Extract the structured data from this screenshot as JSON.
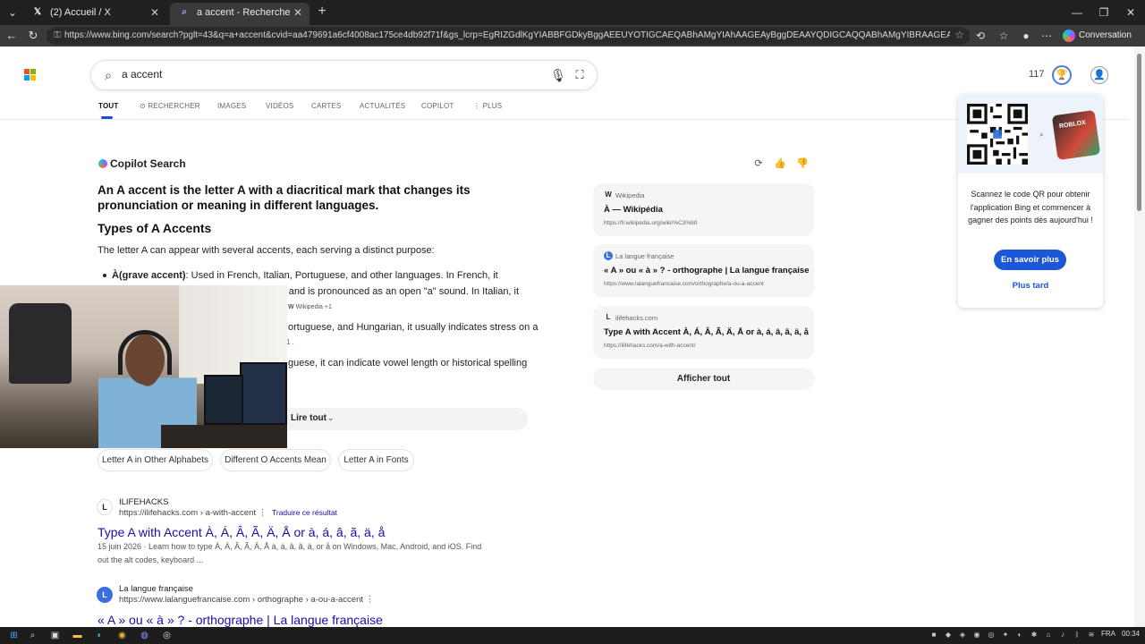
{
  "browser": {
    "tabs": [
      {
        "label": "(2) Accueil / X",
        "icon": "x-logo-icon"
      },
      {
        "label": "a accent - Recherche",
        "icon": "bing-search-icon"
      }
    ],
    "url": "https://www.bing.com/search?pglt=43&q=a+accent&cvid=aa479691a6cf4008ac175ce4db92f71f&gs_lcrp=EgRIZGdlKgYIABBFGDkyBggAEEUYOTIGCAEQABhAMgYIAhAAGEAyBggDEAAYQDIGCAQQABhAMgYIBRAAGEAyBggGEAAYQDIGCA...",
    "conversation_label": "Conversation"
  },
  "bing": {
    "query": "a accent",
    "points": "117",
    "scopes": [
      "TOUT",
      "RECHERCHER",
      "IMAGES",
      "VIDÉOS",
      "CARTES",
      "ACTUALITÉS",
      "COPILOT",
      "PLUS"
    ]
  },
  "copilot": {
    "label": "Copilot Search",
    "headline": "An A accent is the letter A with a diacritical mark that changes its pronunciation or meaning in different languages.",
    "section_title": "Types of A Accents",
    "intro": "The letter A can appear with several accents, each serving a distinct purpose:",
    "bullet_letter": "À",
    "bullet_term": "(grave accent)",
    "bullet_line1": ": Used in French, Italian, Portuguese, and other languages. In French, it",
    "bullet_line2": ") and is pronounced as an open \"a\" sound. In Italian, it",
    "citation": "Wikipedia +1",
    "line3": "ortuguese, and Hungarian, it usually indicates stress on a",
    "line4": "1 .",
    "line5": "guese, it can indicate vowel length or historical spelling",
    "read_all": "Lire tout",
    "chips": [
      "Letter A in Other Alphabets",
      "Different O Accents Mean",
      "Letter A in Fonts"
    ]
  },
  "sources": [
    {
      "site": "Wikipedia",
      "icon": "W",
      "title": "À — Wikipédia",
      "url": "https://fr.wikipedia.org/wiki/%C3%80"
    },
    {
      "site": "La langue française",
      "icon": "L",
      "title": "« A » ou « à » ? - orthographe | La langue française",
      "url": "https://www.lalanguefrancaise.com/orthographe/a-ou-a-accent"
    },
    {
      "site": "ilifehacks.com",
      "icon": "L",
      "title": "Type A with Accent À, Á, Â, Ã, Ä, Å or à, á, â, ã, ä, å",
      "url": "https://ilifehacks.com/a-with-accent/"
    }
  ],
  "show_all": "Afficher tout",
  "qr_panel": {
    "text": "Scannez le code QR pour obtenir l'application Bing et commencer à gagner des points dès aujourd'hui !",
    "button": "En savoir plus",
    "later": "Plus tard",
    "brand": "ROBLOX"
  },
  "results": [
    {
      "source": "ILIFEHACKS",
      "icon": "L",
      "url": "https://ilifehacks.com › a-with-accent",
      "translate": "Traduire ce résultat",
      "title": "Type A with Accent À, Á, Â, Ã, Ä, Å or à, á, â, ã, ä, å",
      "snippet": "15 juin 2026 · Learn how to type À, Á, Â, Ã, Ä, Å à, á, â, ã, ä, or å on Windows, Mac, Android, and iOS. Find out the alt codes, keyboard ..."
    },
    {
      "source": "La langue française",
      "icon": "L",
      "url": "https://www.lalanguefrancaise.com › orthographe › a-ou-a-accent",
      "title": "« A » ou « à » ? - orthographe | La langue française"
    }
  ],
  "taskbar": {
    "lang": "FRA",
    "time": "00:34"
  },
  "colors": {
    "accent": "#174ae4",
    "link": "#1a0dab",
    "button": "#1b57d6"
  }
}
